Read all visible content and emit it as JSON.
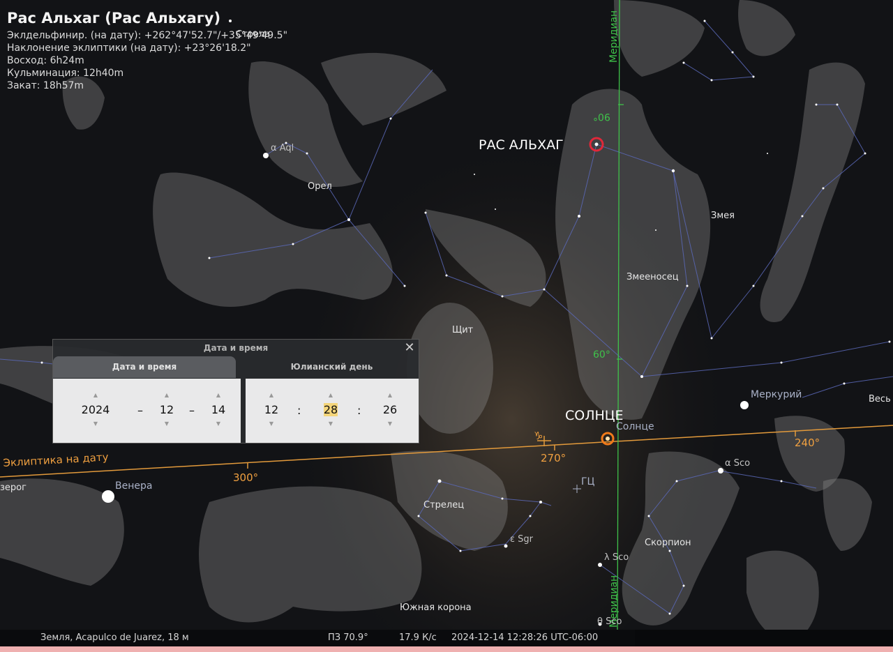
{
  "object": {
    "title": "Рас Альхаг (Рас Альхагу)",
    "lines": [
      "Эклдельфинир. (на дату): +262°47'52.7\"/+35°49'49.5\"",
      "Наклонение эклиптики (на дату): +23°26'18.2\"",
      "Восход: 6h24m",
      "Кульминация: 12h40m",
      "Закат: 18h57m"
    ]
  },
  "sky_labels": {
    "strela": "Стрела",
    "aql": "α Aql",
    "orel": "Орел",
    "ras_alhag": "РАС АЛЬХАГ",
    "zmeya": "Змея",
    "zmeenosec": "Змееносец",
    "shit": "Щит",
    "merkuriy": "Меркурий",
    "ves": "Весь",
    "solnce_big": "СОЛНЦЕ",
    "solnce_small": "Солнце",
    "ecliptic": "Эклиптика на дату",
    "kozerog": "зерог",
    "venera": "Венера",
    "deg300": "300°",
    "deg270": "270°",
    "deg240": "240°",
    "deg60": "60°",
    "deg90": "90°",
    "gc": "ГЦ",
    "alpha_sco": "α Sco",
    "strelec": "Стрелец",
    "eps_sgr": "ε Sgr",
    "skorpion": "Скорпион",
    "lambda_sco": "λ Sco",
    "theta_sco": "θ Sco",
    "yuzhnaya_korona": "Южная корона",
    "meridian_top": "Меридиан",
    "meridian_bottom": "Меридиан",
    "capricorn_symbol": "♑"
  },
  "dialog": {
    "title": "Дата и время",
    "tabs": [
      "Дата и время",
      "Юлианский день"
    ],
    "date": {
      "year": "2024",
      "month": "12",
      "day": "14",
      "sep": "–"
    },
    "time": {
      "hour": "12",
      "minute": "28",
      "second": "26",
      "sep": ":"
    }
  },
  "status_bar": {
    "location": "Земля, Acapulco de Juarez, 18 м",
    "fov": "ПЗ 70.9°",
    "fps": "17.9 К/с",
    "datetime": "2024-12-14 12:28:26 UTC-06:00"
  },
  "colors": {
    "ecliptic": "#e39a3b",
    "meridian": "#3fc24a",
    "constellation_lines": "#5a68b8",
    "selection_ring": "#e0283a",
    "sun_ring": "#f07a1a"
  }
}
